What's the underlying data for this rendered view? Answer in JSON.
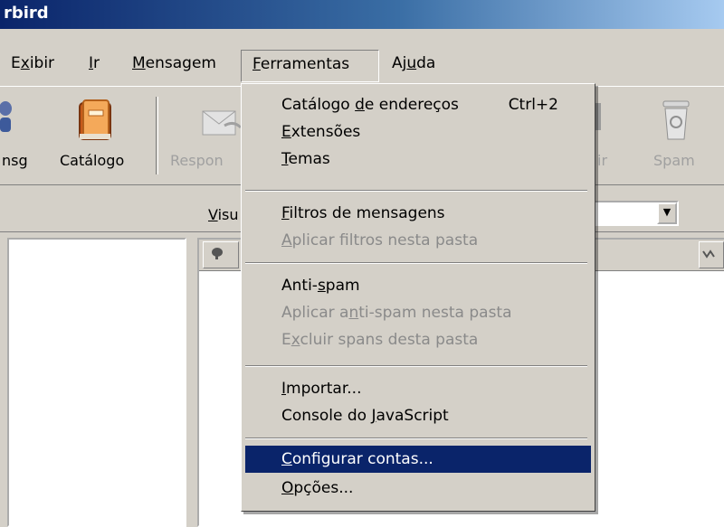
{
  "window": {
    "title": "rbird"
  },
  "menubar": {
    "items": [
      {
        "label": "Exibir",
        "key": "x"
      },
      {
        "label": "Ir",
        "key": "I"
      },
      {
        "label": "Mensagem",
        "key": "M"
      },
      {
        "label": "Ferramentas",
        "key": "F"
      },
      {
        "label": "Ajuda",
        "key": "u"
      }
    ]
  },
  "toolbar": {
    "msg_label": "nsg",
    "catalog_label": "Catálogo",
    "reply_label": "Respon",
    "delete_label": "ir",
    "spam_label": "Spam"
  },
  "filterbar": {
    "view_label": "Visu"
  },
  "dropdown": {
    "address_book": {
      "label": "Catálogo de endereços",
      "shortcut": "Ctrl+2"
    },
    "extensions": "Extensões",
    "themes": "Temas",
    "message_filters": "Filtros de mensagens",
    "apply_filters": "Aplicar filtros nesta pasta",
    "antispam": "Anti-spam",
    "apply_antispam": "Aplicar anti-spam nesta pasta",
    "delete_spam": "Excluir spans desta pasta",
    "import": "Importar...",
    "js_console": "Console do JavaScript",
    "account_settings": "Configurar contas...",
    "options": "Opções..."
  },
  "colors": {
    "highlight": "#0a246a",
    "title_start": "#0a246a",
    "face": "#d4d0c8"
  },
  "icons": {
    "catalog": "address-book-icon",
    "reply": "reply-icon",
    "spam": "trash-can-icon",
    "msg": "person-icon"
  }
}
